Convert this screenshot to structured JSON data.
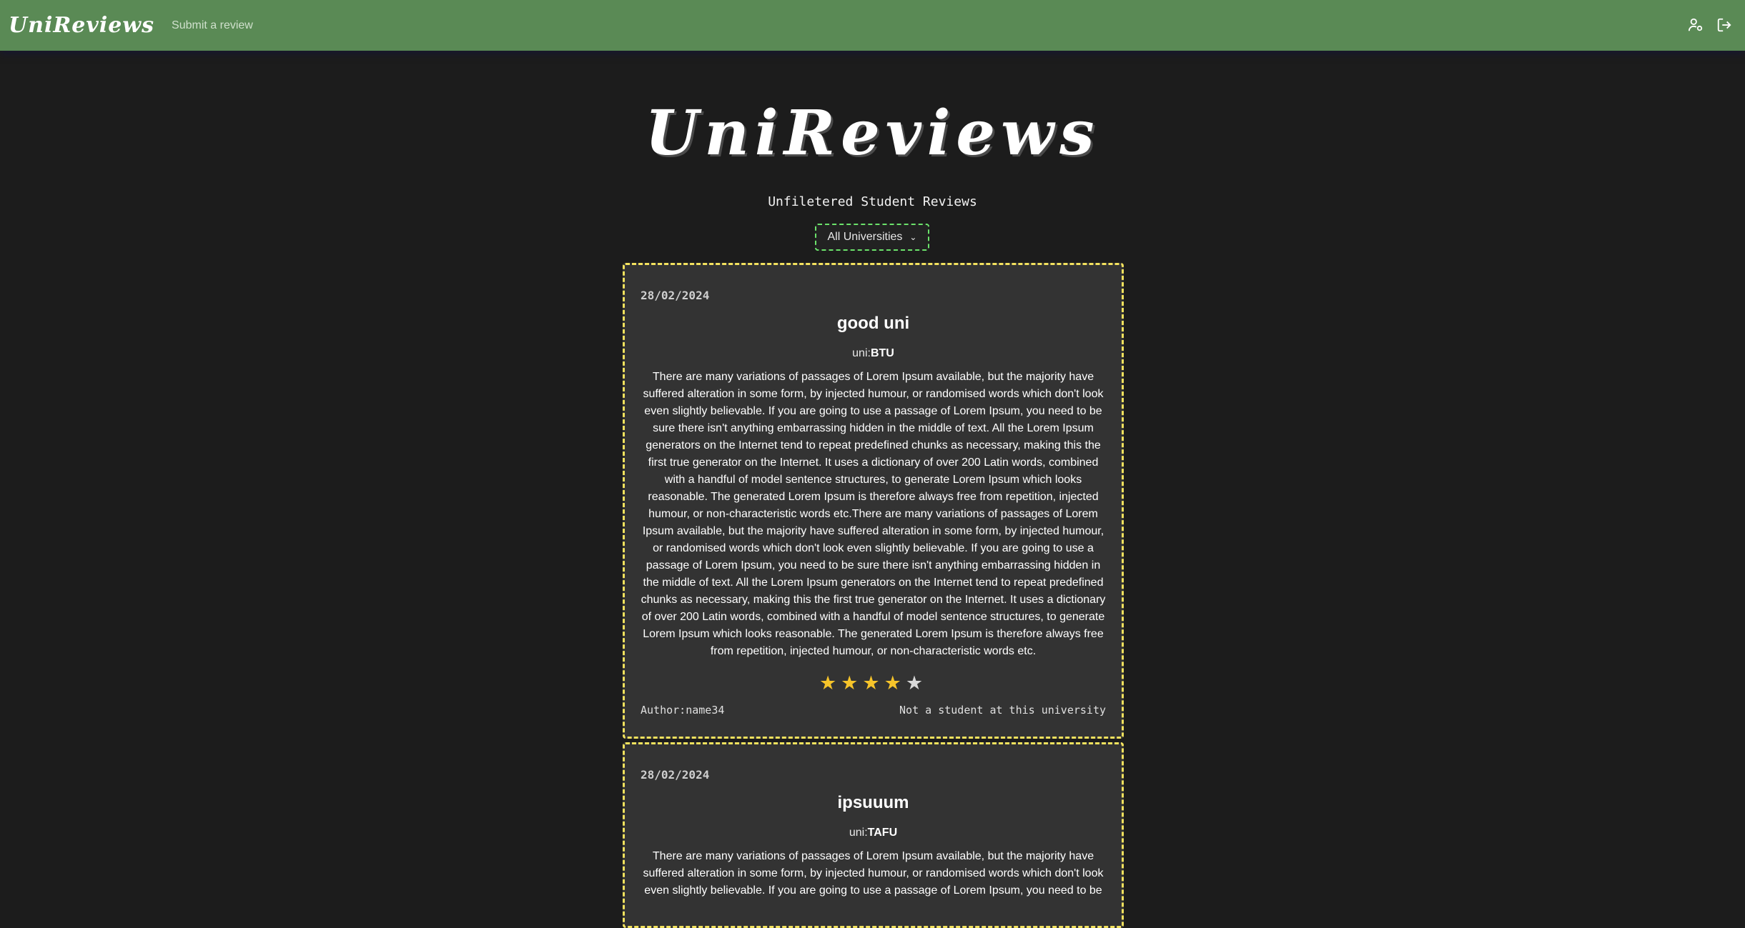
{
  "navbar": {
    "brand": "UniReviews",
    "submit_link": "Submit a review",
    "icons": [
      "user-settings-icon",
      "logout-icon"
    ]
  },
  "hero": {
    "title": "UniReviews",
    "subtitle": "Unfiletered Student Reviews"
  },
  "filter": {
    "selected": "All Universities"
  },
  "reviews": [
    {
      "date": "28/02/2024",
      "title": "good uni",
      "uni_prefix": "uni:",
      "uni": "BTU",
      "body": "There are many variations of passages of Lorem Ipsum available, but the majority have suffered alteration in some form, by injected humour, or randomised words which don't look even slightly believable. If you are going to use a passage of Lorem Ipsum, you need to be sure there isn't anything embarrassing hidden in the middle of text. All the Lorem Ipsum generators on the Internet tend to repeat predefined chunks as necessary, making this the first true generator on the Internet. It uses a dictionary of over 200 Latin words, combined with a handful of model sentence structures, to generate Lorem Ipsum which looks reasonable. The generated Lorem Ipsum is therefore always free from repetition, injected humour, or non-characteristic words etc.There are many variations of passages of Lorem Ipsum available, but the majority have suffered alteration in some form, by injected humour, or randomised words which don't look even slightly believable. If you are going to use a passage of Lorem Ipsum, you need to be sure there isn't anything embarrassing hidden in the middle of text. All the Lorem Ipsum generators on the Internet tend to repeat predefined chunks as necessary, making this the first true generator on the Internet. It uses a dictionary of over 200 Latin words, combined with a handful of model sentence structures, to generate Lorem Ipsum which looks reasonable. The generated Lorem Ipsum is therefore always free from repetition, injected humour, or non-characteristic words etc.",
      "rating": 4,
      "rating_max": 5,
      "author": "Author:name34",
      "status": "Not a student at this university"
    },
    {
      "date": "28/02/2024",
      "title": "ipsuuum",
      "uni_prefix": "uni:",
      "uni": "TAFU",
      "body": "There are many variations of passages of Lorem Ipsum available, but the majority have suffered alteration in some form, by injected humour, or randomised words which don't look even slightly believable. If you are going to use a passage of Lorem Ipsum, you need to be"
    }
  ],
  "colors": {
    "navbar": "#5a8a55",
    "background": "#1c1c1c",
    "card": "#333333",
    "card_border": "#f2e15e",
    "select_border": "#6be36b",
    "star": "#f6c42a"
  }
}
